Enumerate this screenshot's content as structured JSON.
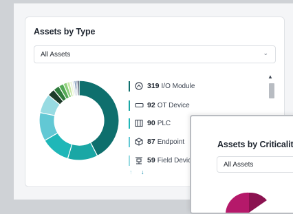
{
  "colors": {
    "teal_dark": "#0e6f6d",
    "teal_mid": "#1aa7a5",
    "teal_light": "#62c8d4",
    "teal_pale": "#98dbe2",
    "green_dark": "#1d3b2a",
    "green": "#2e7b3c",
    "magenta": "#b5196a"
  },
  "card1": {
    "title": "Assets by Type",
    "filter": {
      "selected": "All Assets"
    },
    "legend": [
      {
        "count": "319",
        "label": "I/O Module",
        "icon": "io-module-icon",
        "color": "#0e6f6d"
      },
      {
        "count": "92",
        "label": "OT Device",
        "icon": "ot-device-icon",
        "color": "#1aa7a5"
      },
      {
        "count": "90",
        "label": "PLC",
        "icon": "plc-icon",
        "color": "#1fb7b8"
      },
      {
        "count": "87",
        "label": "Endpoint",
        "icon": "endpoint-icon",
        "color": "#62c8d4"
      },
      {
        "count": "59",
        "label": "Field Devic",
        "icon": "field-device-icon",
        "color": "#98dbe2"
      }
    ],
    "nav_arrows": {
      "up": "↑",
      "down": "↓"
    }
  },
  "card2": {
    "title": "Assets by Criticality",
    "filter": {
      "selected": "All Assets"
    }
  },
  "chart_data": [
    {
      "type": "pie",
      "title": "Assets by Type",
      "categories": [
        "I/O Module",
        "OT Device",
        "PLC",
        "Endpoint",
        "Field Devic"
      ],
      "values": [
        319,
        92,
        90,
        87,
        59
      ]
    }
  ]
}
